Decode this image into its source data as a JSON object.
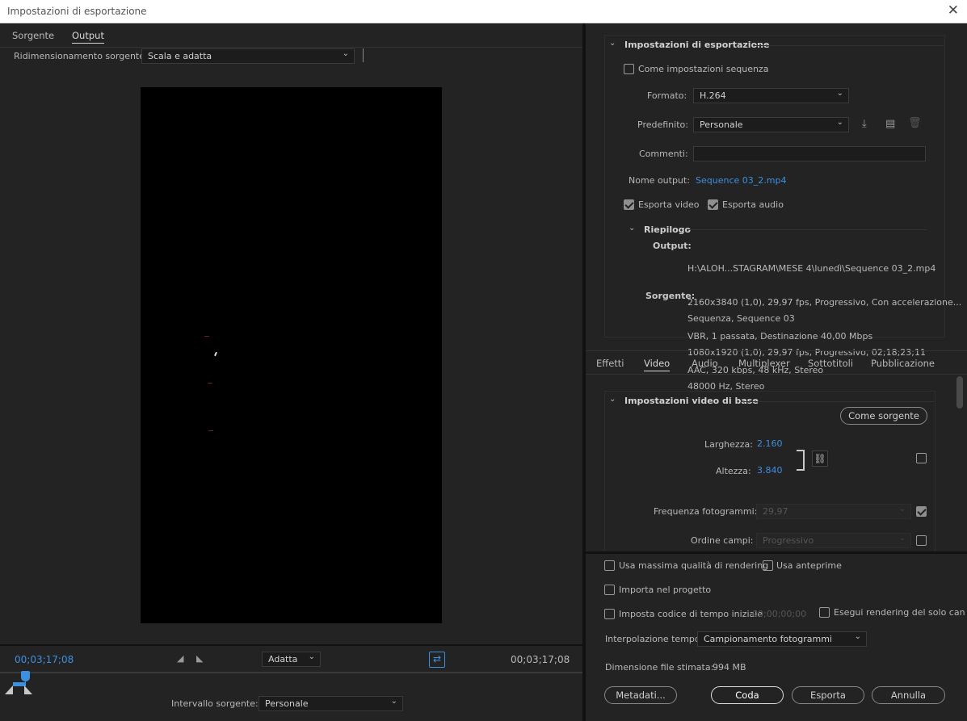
{
  "window": {
    "title": "Impostazioni di esportazione"
  },
  "left_tabs": [
    "Sorgente",
    "Output"
  ],
  "scaling": {
    "label": "Ridimensionamento sorgente:",
    "value": "Scala e adatta"
  },
  "playback": {
    "time_left": "00;03;17;08",
    "time_right": "00;03;17;08",
    "fit_value": "Adatta",
    "range_label": "Intervallo sorgente:",
    "range_value": "Personale"
  },
  "export_settings": {
    "header": "Impostazioni di esportazione",
    "match_sequence": "Come impostazioni sequenza",
    "format_label": "Formato:",
    "format_value": "H.264",
    "preset_label": "Predefinito:",
    "preset_value": "Personale",
    "comments_label": "Commenti:",
    "output_name_label": "Nome output:",
    "output_name_value": "Sequence 03_2.mp4",
    "export_video": "Esporta video",
    "export_audio": "Esporta audio"
  },
  "summary": {
    "header": "Riepilogo",
    "output_label": "Output:",
    "output_lines": [
      "H:\\ALOH...STAGRAM\\MESE 4\\lunedì\\Sequence 03_2.mp4",
      "2160x3840 (1,0), 29,97 fps, Progressivo, Con accelerazione...",
      "VBR, 1 passata, Destinazione 40,00 Mbps",
      "AAC, 320 kbps, 48 kHz, Stereo"
    ],
    "source_label": "Sorgente:",
    "source_lines": [
      "Sequenza, Sequence 03",
      "1080x1920 (1,0), 29,97 fps, Progressivo, 02;18;23;11",
      "48000 Hz, Stereo"
    ]
  },
  "right_tabs": [
    "Effetti",
    "Video",
    "Audio",
    "Multiplexer",
    "Sottotitoli",
    "Pubblicazione"
  ],
  "video_basic": {
    "header": "Impostazioni video di base",
    "match_source_btn": "Come sorgente",
    "width_label": "Larghezza:",
    "width_value": "2.160",
    "height_label": "Altezza:",
    "height_value": "3.840",
    "fps_label": "Frequenza fotogrammi:",
    "fps_value": "29,97",
    "field_label": "Ordine campi:",
    "field_value": "Progressivo"
  },
  "bottom_options": {
    "max_quality": "Usa massima qualità di rendering",
    "use_previews": "Usa anteprime",
    "import_project": "Importa nel progetto",
    "set_timecode": "Imposta codice di tempo iniziale",
    "timecode_value": "00;00;00;00",
    "alpha_only": "Esegui rendering del solo canale alfa",
    "interp_label": "Interpolazione tempo:",
    "interp_value": "Campionamento fotogrammi",
    "filesize_label": "Dimensione file stimata:",
    "filesize_value": "994 MB"
  },
  "buttons": {
    "metadata": "Metadati...",
    "queue": "Coda",
    "export": "Esporta",
    "cancel": "Annulla"
  }
}
